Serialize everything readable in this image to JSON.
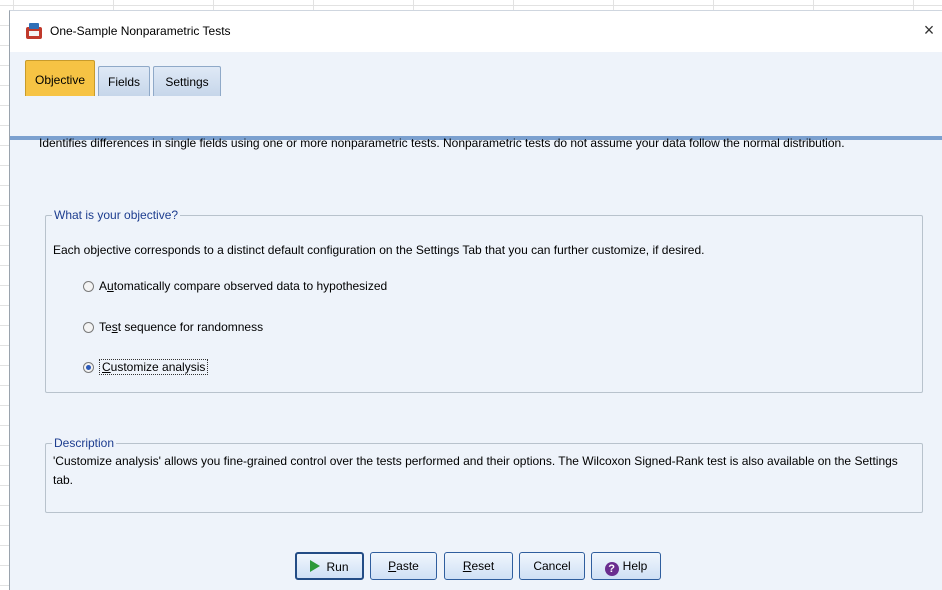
{
  "window": {
    "title": "One-Sample Nonparametric Tests",
    "close_glyph": "×"
  },
  "tabs": [
    {
      "label": "Objective",
      "active": true
    },
    {
      "label": "Fields",
      "active": false
    },
    {
      "label": "Settings",
      "active": false
    }
  ],
  "intro": "Identifies differences in single fields using one or more nonparametric tests. Nonparametric tests do not assume your data follow the normal distribution.",
  "objective_group": {
    "legend": "What is your objective?",
    "help": "Each objective corresponds to a distinct default configuration on the Settings Tab that you can further customize, if desired.",
    "options": [
      {
        "pre": "A",
        "ul": "u",
        "post": "tomatically compare observed data to hypothesized",
        "checked": false
      },
      {
        "pre": "Te",
        "ul": "s",
        "post": "t sequence for randomness",
        "checked": false
      },
      {
        "pre": "",
        "ul": "C",
        "post": "ustomize analysis",
        "checked": true
      }
    ]
  },
  "description_group": {
    "legend": "Description",
    "text": "'Customize analysis' allows you fine-grained control over the tests performed and their options.  The Wilcoxon Signed-Rank test is also available on the Settings tab."
  },
  "buttons": {
    "run": "Run",
    "paste": {
      "ul": "P",
      "post": "aste"
    },
    "reset": {
      "ul": "R",
      "post": "eset"
    },
    "cancel": "Cancel",
    "help": "Help"
  },
  "icons": {
    "app": "spss-app-icon",
    "run": "play-icon",
    "help": "question-icon"
  },
  "colors": {
    "dialog_bg": "#eef3fa",
    "active_tab": "#f6c344",
    "legend_text": "#1d3d8f",
    "button_border": "#2f5e9e"
  }
}
